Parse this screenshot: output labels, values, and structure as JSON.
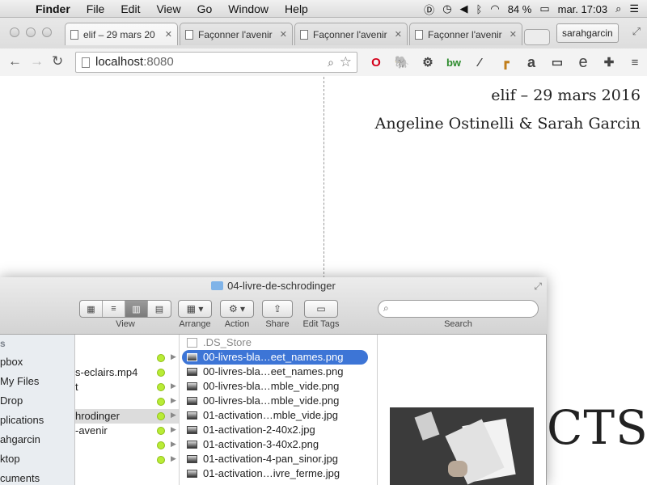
{
  "menubar": {
    "app_name": "Finder",
    "items": [
      "File",
      "Edit",
      "View",
      "Go",
      "Window",
      "Help"
    ],
    "battery": "84 %",
    "clock": "mar. 17:03"
  },
  "browser": {
    "tabs": [
      {
        "label": "elif – 29 mars 20"
      },
      {
        "label": "Façonner l'avenir"
      },
      {
        "label": "Façonner l'avenir"
      },
      {
        "label": "Façonner l'avenir"
      }
    ],
    "user": "sarahgarcin",
    "address": {
      "host": "localhost",
      "port": ":8080"
    },
    "extensions": [
      "opera-icon",
      "evernote-icon",
      "gear-icon",
      "bw-icon",
      "eyedropper-icon",
      "ruler-icon",
      "amazon-icon",
      "cast-icon",
      "e-icon",
      "puzzle-icon",
      "menu-icon"
    ],
    "ext_glyphs": [
      "O",
      "🐘",
      "⚙",
      "bw",
      "⁄",
      "┏",
      "a",
      "▭",
      "e",
      "✚",
      "≡"
    ]
  },
  "page": {
    "title_line1": "elif – 29 mars 2016",
    "title_line2": "Angeline Ostinelli & Sarah Garcin",
    "big_text": "CTS"
  },
  "finder": {
    "title": "04-livre-de-schrodinger",
    "toolbar": {
      "view_label": "View",
      "arrange_label": "Arrange",
      "action_label": "Action",
      "share_label": "Share",
      "edit_tags_label": "Edit Tags",
      "search_label": "Search",
      "search_placeholder": ""
    },
    "sidebar": {
      "heading": "s",
      "items": [
        "pbox",
        "My Files",
        "Drop",
        "plications",
        "ahgarcin",
        "ktop",
        "cuments"
      ]
    },
    "column1": [
      {
        "name": "",
        "selected": false
      },
      {
        "name": "s-eclairs.mp4",
        "selected": false
      },
      {
        "name": "t",
        "selected": false
      },
      {
        "name": "",
        "selected": false
      },
      {
        "name": "hrodinger",
        "selected": true
      },
      {
        "name": "-avenir",
        "selected": false
      },
      {
        "name": "",
        "selected": false
      },
      {
        "name": "",
        "selected": false
      }
    ],
    "files": [
      ".DS_Store",
      "00-livres-bla…eet_names.png",
      "00-livres-bla…eet_names.png",
      "00-livres-bla…mble_vide.png",
      "00-livres-bla…mble_vide.png",
      "01-activation…mble_vide.jpg",
      "01-activation-2-40x2.jpg",
      "01-activation-3-40x2.png",
      "01-activation-4-pan_sinor.jpg",
      "01-activation…ivre_ferme.jpg"
    ],
    "selected_file_index": 1,
    "accent_color": "#3d75d6",
    "tag_color": "#b9ec36"
  }
}
